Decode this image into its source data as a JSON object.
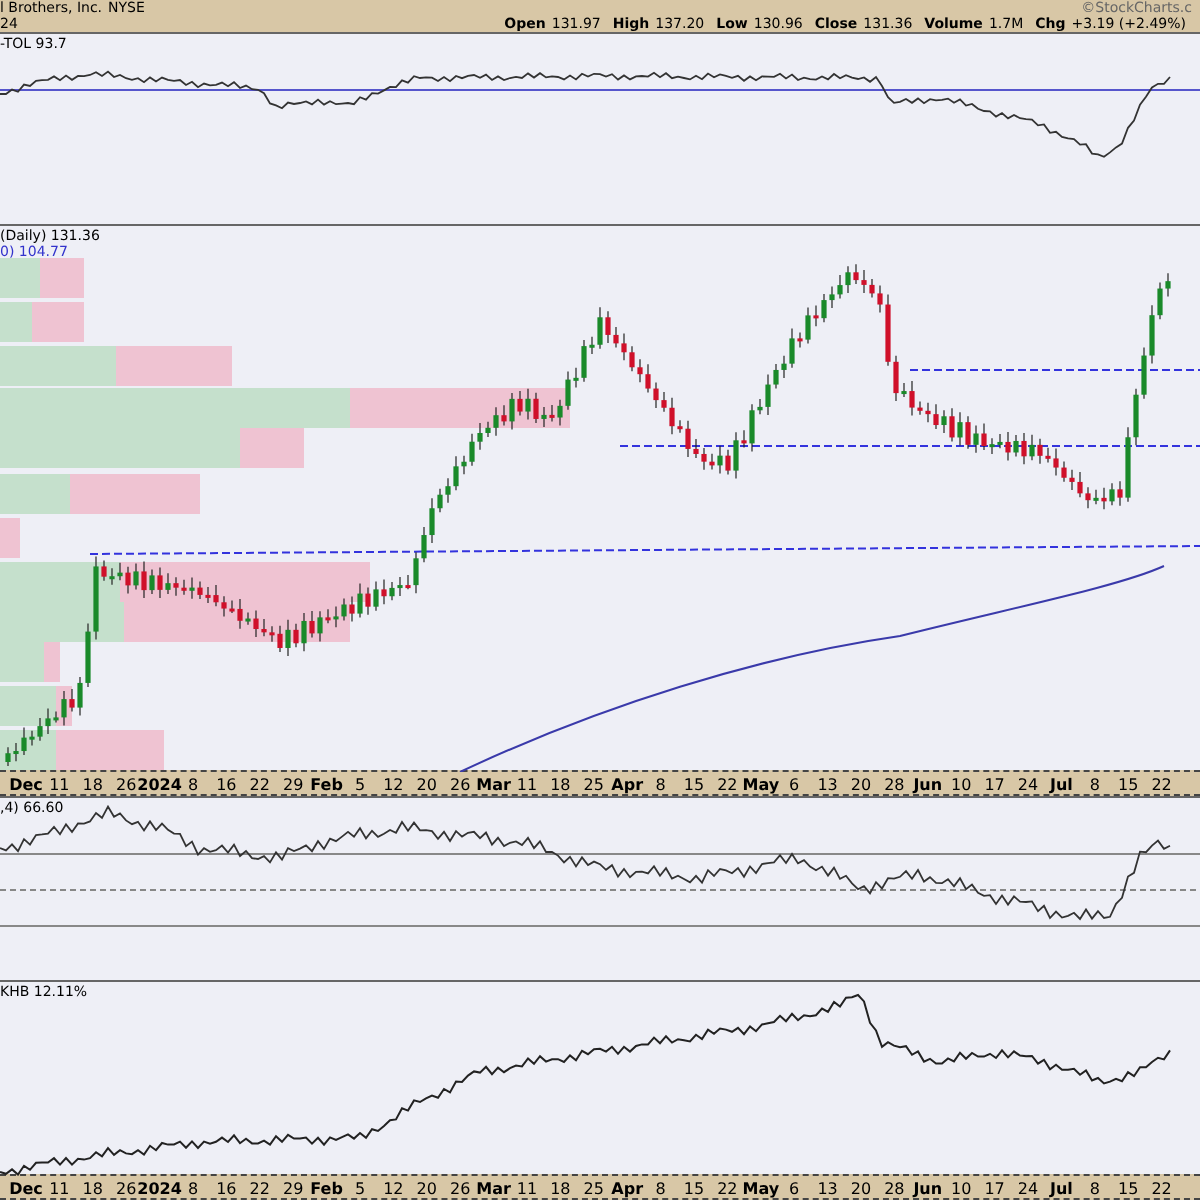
{
  "header": {
    "company": "l Brothers, Inc.",
    "exchange": "NYSE",
    "date": "24",
    "brand": "©StockCharts.c",
    "quote": [
      {
        "label": "Open",
        "value": "131.97"
      },
      {
        "label": "High",
        "value": "137.20"
      },
      {
        "label": "Low",
        "value": "130.96"
      },
      {
        "label": "Close",
        "value": "131.36"
      },
      {
        "label": "Volume",
        "value": "1.7M"
      },
      {
        "label": "Chg",
        "value": "+3.19 (+2.49%)"
      }
    ]
  },
  "panels": [
    {
      "kind": "relative",
      "labels": [
        {
          "text": "-TOL 93.7",
          "color": "#000000"
        }
      ]
    },
    {
      "kind": "price",
      "labels": [
        {
          "text": "(Daily) 131.36",
          "color": "#000000"
        },
        {
          "text": "0) 104.77",
          "color": "#3333cc"
        }
      ]
    },
    {
      "kind": "axis",
      "ticks": [
        {
          "text": "Dec",
          "major": true
        },
        {
          "text": "11",
          "major": false
        },
        {
          "text": "18",
          "major": false
        },
        {
          "text": "26",
          "major": false
        },
        {
          "text": "2024",
          "major": true
        },
        {
          "text": "8",
          "major": false
        },
        {
          "text": "16",
          "major": false
        },
        {
          "text": "22",
          "major": false
        },
        {
          "text": "29",
          "major": false
        },
        {
          "text": "Feb",
          "major": true
        },
        {
          "text": "5",
          "major": false
        },
        {
          "text": "12",
          "major": false
        },
        {
          "text": "20",
          "major": false
        },
        {
          "text": "26",
          "major": false
        },
        {
          "text": "Mar",
          "major": true
        },
        {
          "text": "11",
          "major": false
        },
        {
          "text": "18",
          "major": false
        },
        {
          "text": "25",
          "major": false
        },
        {
          "text": "Apr",
          "major": true
        },
        {
          "text": "8",
          "major": false
        },
        {
          "text": "15",
          "major": false
        },
        {
          "text": "22",
          "major": false
        },
        {
          "text": "May",
          "major": true
        },
        {
          "text": "6",
          "major": false
        },
        {
          "text": "13",
          "major": false
        },
        {
          "text": "20",
          "major": false
        },
        {
          "text": "28",
          "major": false
        },
        {
          "text": "Jun",
          "major": true
        },
        {
          "text": "10",
          "major": false
        },
        {
          "text": "17",
          "major": false
        },
        {
          "text": "24",
          "major": false
        },
        {
          "text": "Jul",
          "major": true
        },
        {
          "text": "8",
          "major": false
        },
        {
          "text": "15",
          "major": false
        },
        {
          "text": "22",
          "major": false
        }
      ]
    },
    {
      "kind": "rsi",
      "labels": [
        {
          "text": ",4) 66.60",
          "color": "#000000"
        }
      ]
    },
    {
      "kind": "ratio",
      "labels": [
        {
          "text": "KHB 12.11%",
          "color": "#000000"
        }
      ]
    },
    {
      "kind": "axis",
      "ticks": [
        {
          "text": "Dec",
          "major": true
        },
        {
          "text": "11",
          "major": false
        },
        {
          "text": "18",
          "major": false
        },
        {
          "text": "26",
          "major": false
        },
        {
          "text": "2024",
          "major": true
        },
        {
          "text": "8",
          "major": false
        },
        {
          "text": "16",
          "major": false
        },
        {
          "text": "22",
          "major": false
        },
        {
          "text": "29",
          "major": false
        },
        {
          "text": "Feb",
          "major": true
        },
        {
          "text": "5",
          "major": false
        },
        {
          "text": "12",
          "major": false
        },
        {
          "text": "20",
          "major": false
        },
        {
          "text": "26",
          "major": false
        },
        {
          "text": "Mar",
          "major": true
        },
        {
          "text": "11",
          "major": false
        },
        {
          "text": "18",
          "major": false
        },
        {
          "text": "25",
          "major": false
        },
        {
          "text": "Apr",
          "major": true
        },
        {
          "text": "8",
          "major": false
        },
        {
          "text": "15",
          "major": false
        },
        {
          "text": "22",
          "major": false
        },
        {
          "text": "May",
          "major": true
        },
        {
          "text": "6",
          "major": false
        },
        {
          "text": "13",
          "major": false
        },
        {
          "text": "20",
          "major": false
        },
        {
          "text": "28",
          "major": false
        },
        {
          "text": "Jun",
          "major": true
        },
        {
          "text": "10",
          "major": false
        },
        {
          "text": "17",
          "major": false
        },
        {
          "text": "24",
          "major": false
        },
        {
          "text": "Jul",
          "major": true
        },
        {
          "text": "8",
          "major": false
        },
        {
          "text": "15",
          "major": false
        },
        {
          "text": "22",
          "major": false
        }
      ]
    }
  ]
}
